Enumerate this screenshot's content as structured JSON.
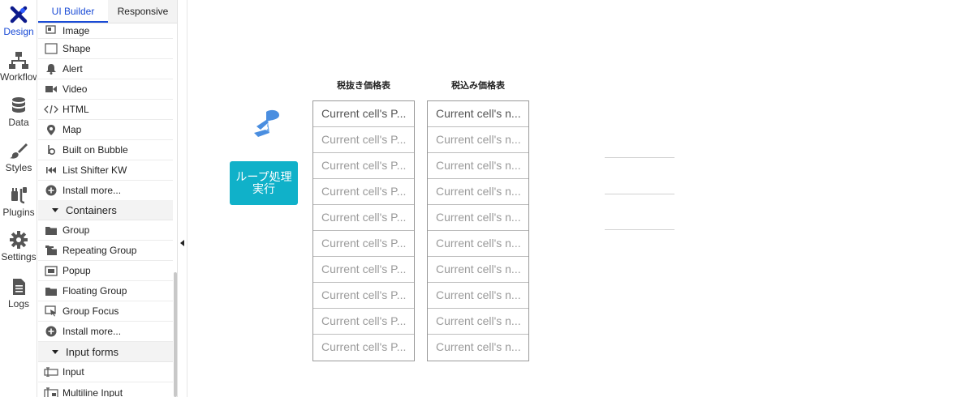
{
  "rail": {
    "items": [
      {
        "label": "Design",
        "icon": "design-icon",
        "active": true
      },
      {
        "label": "Workflow",
        "icon": "workflow-icon"
      },
      {
        "label": "Data",
        "icon": "database-icon"
      },
      {
        "label": "Styles",
        "icon": "brush-icon"
      },
      {
        "label": "Plugins",
        "icon": "plug-icon"
      },
      {
        "label": "Settings",
        "icon": "gear-icon"
      },
      {
        "label": "Logs",
        "icon": "document-icon"
      }
    ]
  },
  "palette": {
    "tabs": [
      {
        "label": "UI Builder",
        "active": true
      },
      {
        "label": "Responsive",
        "active": false
      }
    ],
    "items": {
      "image": "Image",
      "shape": "Shape",
      "alert": "Alert",
      "video": "Video",
      "html": "HTML",
      "map": "Map",
      "built_on_bubble": "Built on Bubble",
      "list_shifter": "List Shifter KW",
      "install_more_1": "Install more...",
      "containers": "Containers",
      "group": "Group",
      "repeating_group": "Repeating Group",
      "popup": "Popup",
      "floating_group": "Floating Group",
      "group_focus": "Group Focus",
      "install_more_2": "Install more...",
      "input_forms": "Input forms",
      "input": "Input",
      "multiline_input": "Multiline Input"
    }
  },
  "canvas": {
    "loop_button_label": "ループ処理実行",
    "table_left": {
      "title": "税抜き価格表",
      "cell_text": "Current cell's P...",
      "rows": 10
    },
    "table_right": {
      "title": "税込み価格表",
      "cell_text": "Current cell's n...",
      "rows": 10
    }
  },
  "colors": {
    "accent_blue": "#1a4bd6",
    "button_teal": "#10b1c9",
    "bubble_icon_blue": "#4a8ee0"
  }
}
